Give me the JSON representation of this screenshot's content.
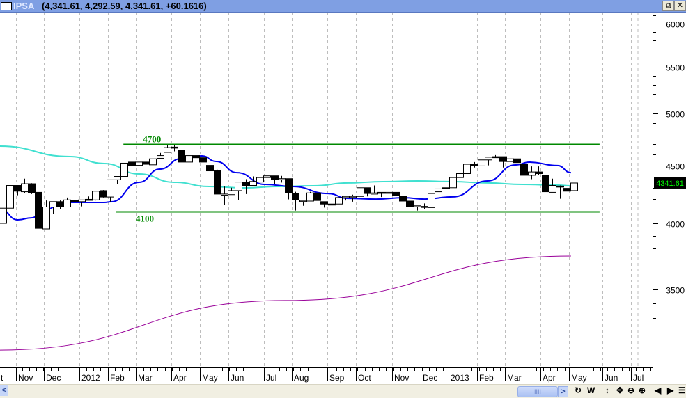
{
  "window": {
    "symbol": "IPSA",
    "values": "(4,341.61, 4,292.59, 4,341.61, +60.1616)",
    "restore_icon": "restore-icon",
    "close_icon": "close-icon"
  },
  "toolbar": {
    "scroll_left": "<",
    "scroll_right": ">",
    "scroll_thumb": "IIII",
    "buttons": [
      {
        "name": "refresh-button",
        "label": "↻"
      },
      {
        "name": "weekly-button",
        "label": "W"
      },
      {
        "name": "vertical-resize-button",
        "label": "↕"
      },
      {
        "name": "pan-button",
        "label": "✥"
      },
      {
        "name": "zoom-out-button",
        "label": "⊖"
      },
      {
        "name": "zoom-in-button",
        "label": "⊕"
      },
      {
        "name": "scroll-back-button",
        "label": "◀"
      },
      {
        "name": "scroll-forward-button",
        "label": "▶"
      },
      {
        "name": "properties-button",
        "label": "☰"
      }
    ]
  },
  "colors": {
    "grid": "#bdbdbd",
    "support": "#008800",
    "ma_short": "#0000ee",
    "ma_long": "#40e0d0",
    "trend": "#990099",
    "last_price_text": "#00ff00"
  },
  "chart_data": {
    "type": "candlestick",
    "title": "IPSA",
    "scale": "log",
    "ylim": [
      3200,
      6150
    ],
    "y_ticks": [
      3500,
      4000,
      4500,
      5000,
      5500,
      6000
    ],
    "y_tick_labels": [
      "3500",
      "4000",
      "4500",
      "5000",
      "5500",
      "6000"
    ],
    "last_price_label": "4341.61",
    "x_unit": "week index",
    "x_tick_labels": [
      {
        "label": "t",
        "week": -0.3
      },
      {
        "label": "Nov",
        "week": 2.15
      },
      {
        "label": "Dec",
        "week": 6.05
      },
      {
        "label": "2012",
        "week": 11.0
      },
      {
        "label": "Feb",
        "week": 15.0
      },
      {
        "label": "Mar",
        "week": 18.9
      },
      {
        "label": "Apr",
        "week": 23.9
      },
      {
        "label": "May",
        "week": 27.9
      },
      {
        "label": "Jun",
        "week": 31.9
      },
      {
        "label": "Jul",
        "week": 36.9
      },
      {
        "label": "Aug",
        "week": 40.8
      },
      {
        "label": "Sep",
        "week": 45.8
      },
      {
        "label": "Oct",
        "week": 49.8
      },
      {
        "label": "Nov",
        "week": 54.8
      },
      {
        "label": "Dec",
        "week": 58.8
      },
      {
        "label": "2013",
        "week": 62.7
      },
      {
        "label": "Feb",
        "week": 66.7
      },
      {
        "label": "Mar",
        "week": 70.6
      },
      {
        "label": "Apr",
        "week": 75.6
      },
      {
        "label": "May",
        "week": 79.6
      },
      {
        "label": "Jun",
        "week": 84.3
      },
      {
        "label": "Jul",
        "week": 88.3
      }
    ],
    "candles_ohlc": [
      [
        4000,
        4130,
        3972,
        4125
      ],
      [
        4125,
        4330,
        4120,
        4320
      ],
      [
        4320,
        4320,
        4235,
        4270
      ],
      [
        4265,
        4380,
        4255,
        4335
      ],
      [
        4335,
        4340,
        4245,
        4255
      ],
      [
        4260,
        4260,
        3960,
        3960
      ],
      [
        3955,
        4190,
        3955,
        4135
      ],
      [
        4135,
        4180,
        4080,
        4180
      ],
      [
        4180,
        4190,
        4120,
        4140
      ],
      [
        4135,
        4215,
        4135,
        4195
      ],
      [
        4190,
        4190,
        4135,
        4180
      ],
      [
        4180,
        4195,
        4140,
        4195
      ],
      [
        4200,
        4225,
        4195,
        4195
      ],
      [
        4195,
        4270,
        4190,
        4270
      ],
      [
        4275,
        4280,
        4215,
        4220
      ],
      [
        4220,
        4370,
        4180,
        4370
      ],
      [
        4370,
        4400,
        4335,
        4400
      ],
      [
        4400,
        4520,
        4395,
        4520
      ],
      [
        4530,
        4530,
        4480,
        4500
      ],
      [
        4500,
        4530,
        4470,
        4530
      ],
      [
        4530,
        4530,
        4460,
        4510
      ],
      [
        4505,
        4580,
        4505,
        4560
      ],
      [
        4565,
        4615,
        4565,
        4590
      ],
      [
        4620,
        4690,
        4620,
        4665
      ],
      [
        4670,
        4690,
        4630,
        4660
      ],
      [
        4640,
        4640,
        4530,
        4530
      ],
      [
        4530,
        4590,
        4500,
        4590
      ],
      [
        4590,
        4595,
        4570,
        4570
      ],
      [
        4570,
        4570,
        4530,
        4530
      ],
      [
        4500,
        4530,
        4450,
        4450
      ],
      [
        4450,
        4460,
        4245,
        4245
      ],
      [
        4235,
        4310,
        4155,
        4245
      ],
      [
        4240,
        4300,
        4240,
        4275
      ],
      [
        4275,
        4350,
        4195,
        4350
      ],
      [
        4350,
        4375,
        4245,
        4320
      ],
      [
        4320,
        4400,
        4320,
        4355
      ],
      [
        4350,
        4390,
        4330,
        4390
      ],
      [
        4390,
        4420,
        4390,
        4405
      ],
      [
        4405,
        4405,
        4335,
        4370
      ],
      [
        4370,
        4405,
        4345,
        4380
      ],
      [
        4380,
        4380,
        4200,
        4255
      ],
      [
        4250,
        4265,
        4105,
        4195
      ],
      [
        4185,
        4195,
        4145,
        4190
      ],
      [
        4185,
        4265,
        4185,
        4255
      ],
      [
        4255,
        4255,
        4190,
        4190
      ],
      [
        4180,
        4180,
        4130,
        4160
      ],
      [
        4160,
        4160,
        4110,
        4155
      ],
      [
        4160,
        4215,
        4160,
        4215
      ],
      [
        4215,
        4225,
        4190,
        4225
      ],
      [
        4220,
        4240,
        4180,
        4225
      ],
      [
        4225,
        4300,
        4225,
        4300
      ],
      [
        4300,
        4300,
        4225,
        4250
      ],
      [
        4245,
        4320,
        4245,
        4255
      ],
      [
        4260,
        4260,
        4220,
        4255
      ],
      [
        4255,
        4260,
        4255,
        4260
      ],
      [
        4260,
        4260,
        4230,
        4230
      ],
      [
        4225,
        4235,
        4120,
        4185
      ],
      [
        4185,
        4190,
        4140,
        4140
      ],
      [
        4140,
        4145,
        4105,
        4145
      ],
      [
        4140,
        4165,
        4120,
        4140
      ],
      [
        4130,
        4250,
        4130,
        4250
      ],
      [
        4265,
        4290,
        4265,
        4290
      ],
      [
        4300,
        4300,
        4295,
        4295
      ],
      [
        4300,
        4410,
        4300,
        4390
      ],
      [
        4390,
        4450,
        4375,
        4425
      ],
      [
        4425,
        4510,
        4425,
        4510
      ],
      [
        4510,
        4530,
        4480,
        4500
      ],
      [
        4495,
        4550,
        4495,
        4550
      ],
      [
        4550,
        4575,
        4500,
        4575
      ],
      [
        4580,
        4595,
        4575,
        4575
      ],
      [
        4580,
        4580,
        4480,
        4535
      ],
      [
        4535,
        4560,
        4450,
        4560
      ],
      [
        4560,
        4590,
        4525,
        4525
      ],
      [
        4510,
        4520,
        4410,
        4410
      ],
      [
        4410,
        4490,
        4375,
        4440
      ],
      [
        4440,
        4490,
        4410,
        4425
      ],
      [
        4410,
        4410,
        4265,
        4265
      ],
      [
        4260,
        4380,
        4260,
        4320
      ],
      [
        4315,
        4320,
        4205,
        4310
      ],
      [
        4295,
        4295,
        4270,
        4270
      ],
      [
        4275,
        4341.61,
        4275,
        4341.61
      ]
    ],
    "series": [
      {
        "name": "long moving average",
        "color_key": "ma_long",
        "points": [
          [
            -0.4,
            4679
          ],
          [
            9.4,
            4581
          ],
          [
            14.2,
            4517
          ],
          [
            19.1,
            4422
          ],
          [
            24,
            4348
          ],
          [
            28.9,
            4311
          ],
          [
            33.8,
            4299
          ],
          [
            38.6,
            4311
          ],
          [
            43.5,
            4317
          ],
          [
            48.4,
            4342
          ],
          [
            53.3,
            4354
          ],
          [
            58.1,
            4360
          ],
          [
            63,
            4354
          ],
          [
            67.9,
            4342
          ],
          [
            72.8,
            4329
          ],
          [
            77.7,
            4323
          ],
          [
            79.6,
            4317
          ]
        ]
      },
      {
        "name": "short moving average",
        "color_key": "ma_short",
        "points": [
          [
            -0.4,
            4120
          ],
          [
            2.1,
            4028
          ],
          [
            4,
            4045
          ],
          [
            6,
            4114
          ],
          [
            8.4,
            4173
          ],
          [
            14.2,
            4173
          ],
          [
            15.2,
            4179
          ],
          [
            19.1,
            4348
          ],
          [
            22,
            4466
          ],
          [
            25,
            4562
          ],
          [
            27.9,
            4587
          ],
          [
            29.9,
            4536
          ],
          [
            32.8,
            4434
          ],
          [
            36.7,
            4329
          ],
          [
            40.6,
            4311
          ],
          [
            45.5,
            4250
          ],
          [
            48.4,
            4208
          ],
          [
            52.3,
            4202
          ],
          [
            56.2,
            4214
          ],
          [
            59.1,
            4202
          ],
          [
            63,
            4221
          ],
          [
            67.9,
            4360
          ],
          [
            71.8,
            4504
          ],
          [
            73.8,
            4529
          ],
          [
            77.7,
            4498
          ],
          [
            79.6,
            4434
          ]
        ]
      },
      {
        "name": "long-term trend",
        "color_key": "trend",
        "points": [
          [
            -0.4,
            3093
          ],
          [
            39.6,
            3420
          ],
          [
            79.6,
            3743
          ]
        ]
      }
    ],
    "annotations": [
      {
        "type": "hline",
        "label": "4700",
        "value": 4700,
        "from_week": 16.9,
        "to_week": 83.6
      },
      {
        "type": "hline",
        "label": "4100",
        "value": 4100,
        "from_week": 15.9,
        "to_week": 83.6
      }
    ]
  }
}
